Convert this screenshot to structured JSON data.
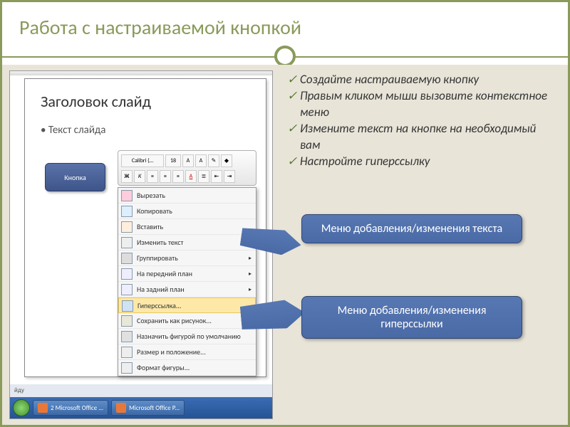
{
  "title": "Работа с настраиваемой кнопкой",
  "instructions": [
    "Создайте настраиваемую кнопку",
    "Правым кликом мыши  вызовите контекстное меню",
    "Измените текст на кнопке на необходимый вам",
    "Настройте гиперссылку"
  ],
  "callouts": {
    "c1": "Меню добавления/изменения текста",
    "c2": "Меню добавления/изменения гиперссылки"
  },
  "powerpoint": {
    "slide_title": "Заголовок слайд",
    "slide_body": "Текст слайда",
    "button_label": "Кнопка",
    "mini_toolbar": {
      "font": "Calibri (…",
      "size": "18"
    },
    "context_menu": [
      {
        "label": "Вырезать",
        "icon": "cut"
      },
      {
        "label": "Копировать",
        "icon": "copy"
      },
      {
        "label": "Вставить",
        "icon": "paste"
      },
      {
        "label": "Изменить текст",
        "icon": "edit",
        "highlight": false,
        "arrow": false
      },
      {
        "label": "Группировать",
        "icon": "group",
        "arrow": true
      },
      {
        "label": "На передний план",
        "icon": "front",
        "arrow": true
      },
      {
        "label": "На задний план",
        "icon": "back",
        "arrow": true
      },
      {
        "label": "Гиперссылка...",
        "icon": "link",
        "highlight": true
      },
      {
        "label": "Сохранить как рисунок...",
        "icon": "pic"
      },
      {
        "label": "Назначить фигурой по умолчанию",
        "icon": "def"
      },
      {
        "label": "Размер и положение...",
        "icon": "size"
      },
      {
        "label": "Формат фигуры...",
        "icon": "format"
      }
    ],
    "status_label": "йду",
    "taskbar": {
      "app1": "2 Microsoft Office ...",
      "app2": "Microsoft Office P..."
    }
  }
}
